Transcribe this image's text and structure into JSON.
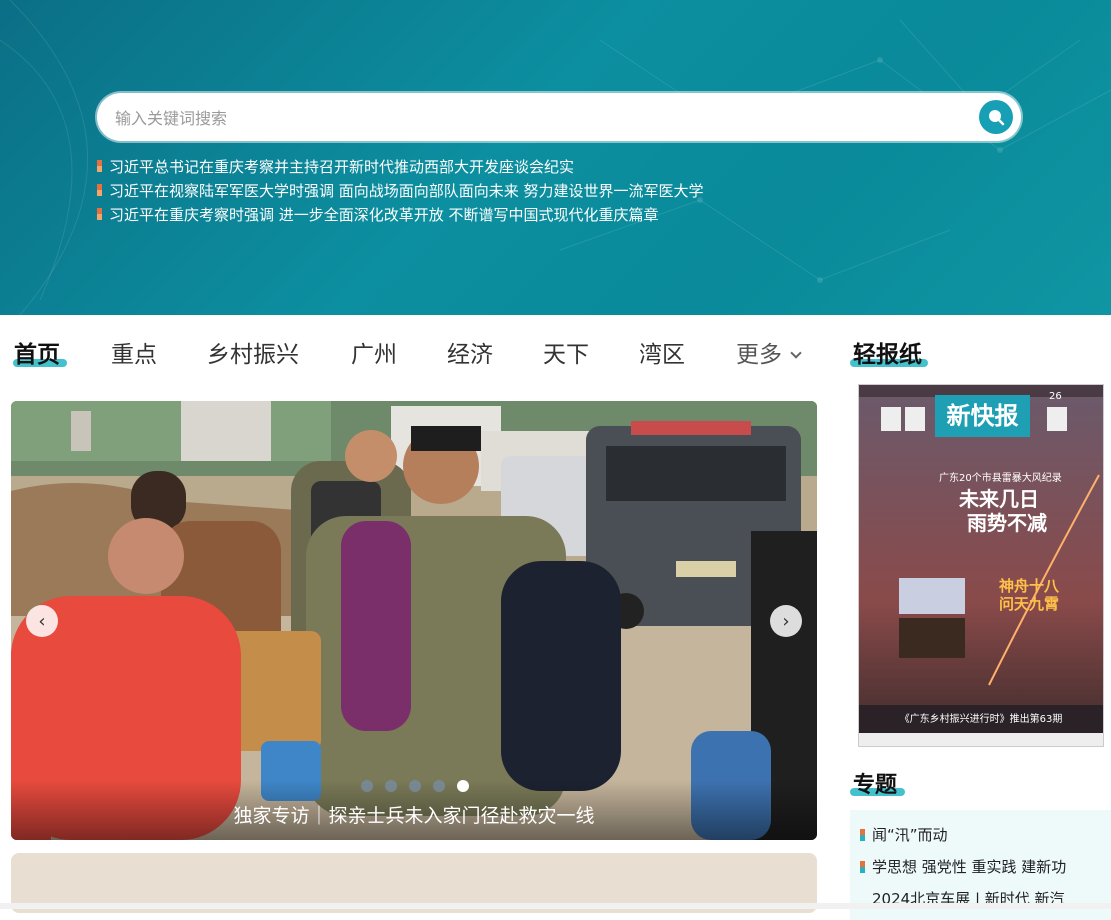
{
  "search": {
    "placeholder": "输入关键词搜索"
  },
  "headlines": [
    "习近平总书记在重庆考察并主持召开新时代推动西部大开发座谈会纪实",
    "习近平在视察陆军军医大学时强调 面向战场面向部队面向未来 努力建设世界一流军医大学",
    "习近平在重庆考察时强调 进一步全面深化改革开放 不断谱写中国式现代化重庆篇章"
  ],
  "nav": {
    "items": [
      "首页",
      "重点",
      "乡村振兴",
      "广州",
      "经济",
      "天下",
      "湾区"
    ],
    "more": "更多",
    "light_paper": "轻报纸"
  },
  "carousel": {
    "caption": "独家专访｜探亲士兵未入家门径赴救灾一线",
    "slide_count": 5,
    "active_index": 4
  },
  "newspaper": {
    "masthead": "新快报",
    "headline": "未来几日",
    "headline2": "雨势不减",
    "side_title": "神舟十八",
    "side_title2": "问天九霄",
    "subheadline": "广东20个市县雷暴大风纪录",
    "footer": "《广东乡村振兴进行时》推出第63期",
    "issue": "26"
  },
  "topics": {
    "title": "专题",
    "items": [
      "闻“汛”而动",
      "学思想 强党性 重实践 建新功",
      "2024北京车展 | 新时代 新汽"
    ]
  },
  "colors": {
    "accent": "#25b6c6",
    "hero": "#0c8fa0",
    "mark": "#e6703e"
  }
}
